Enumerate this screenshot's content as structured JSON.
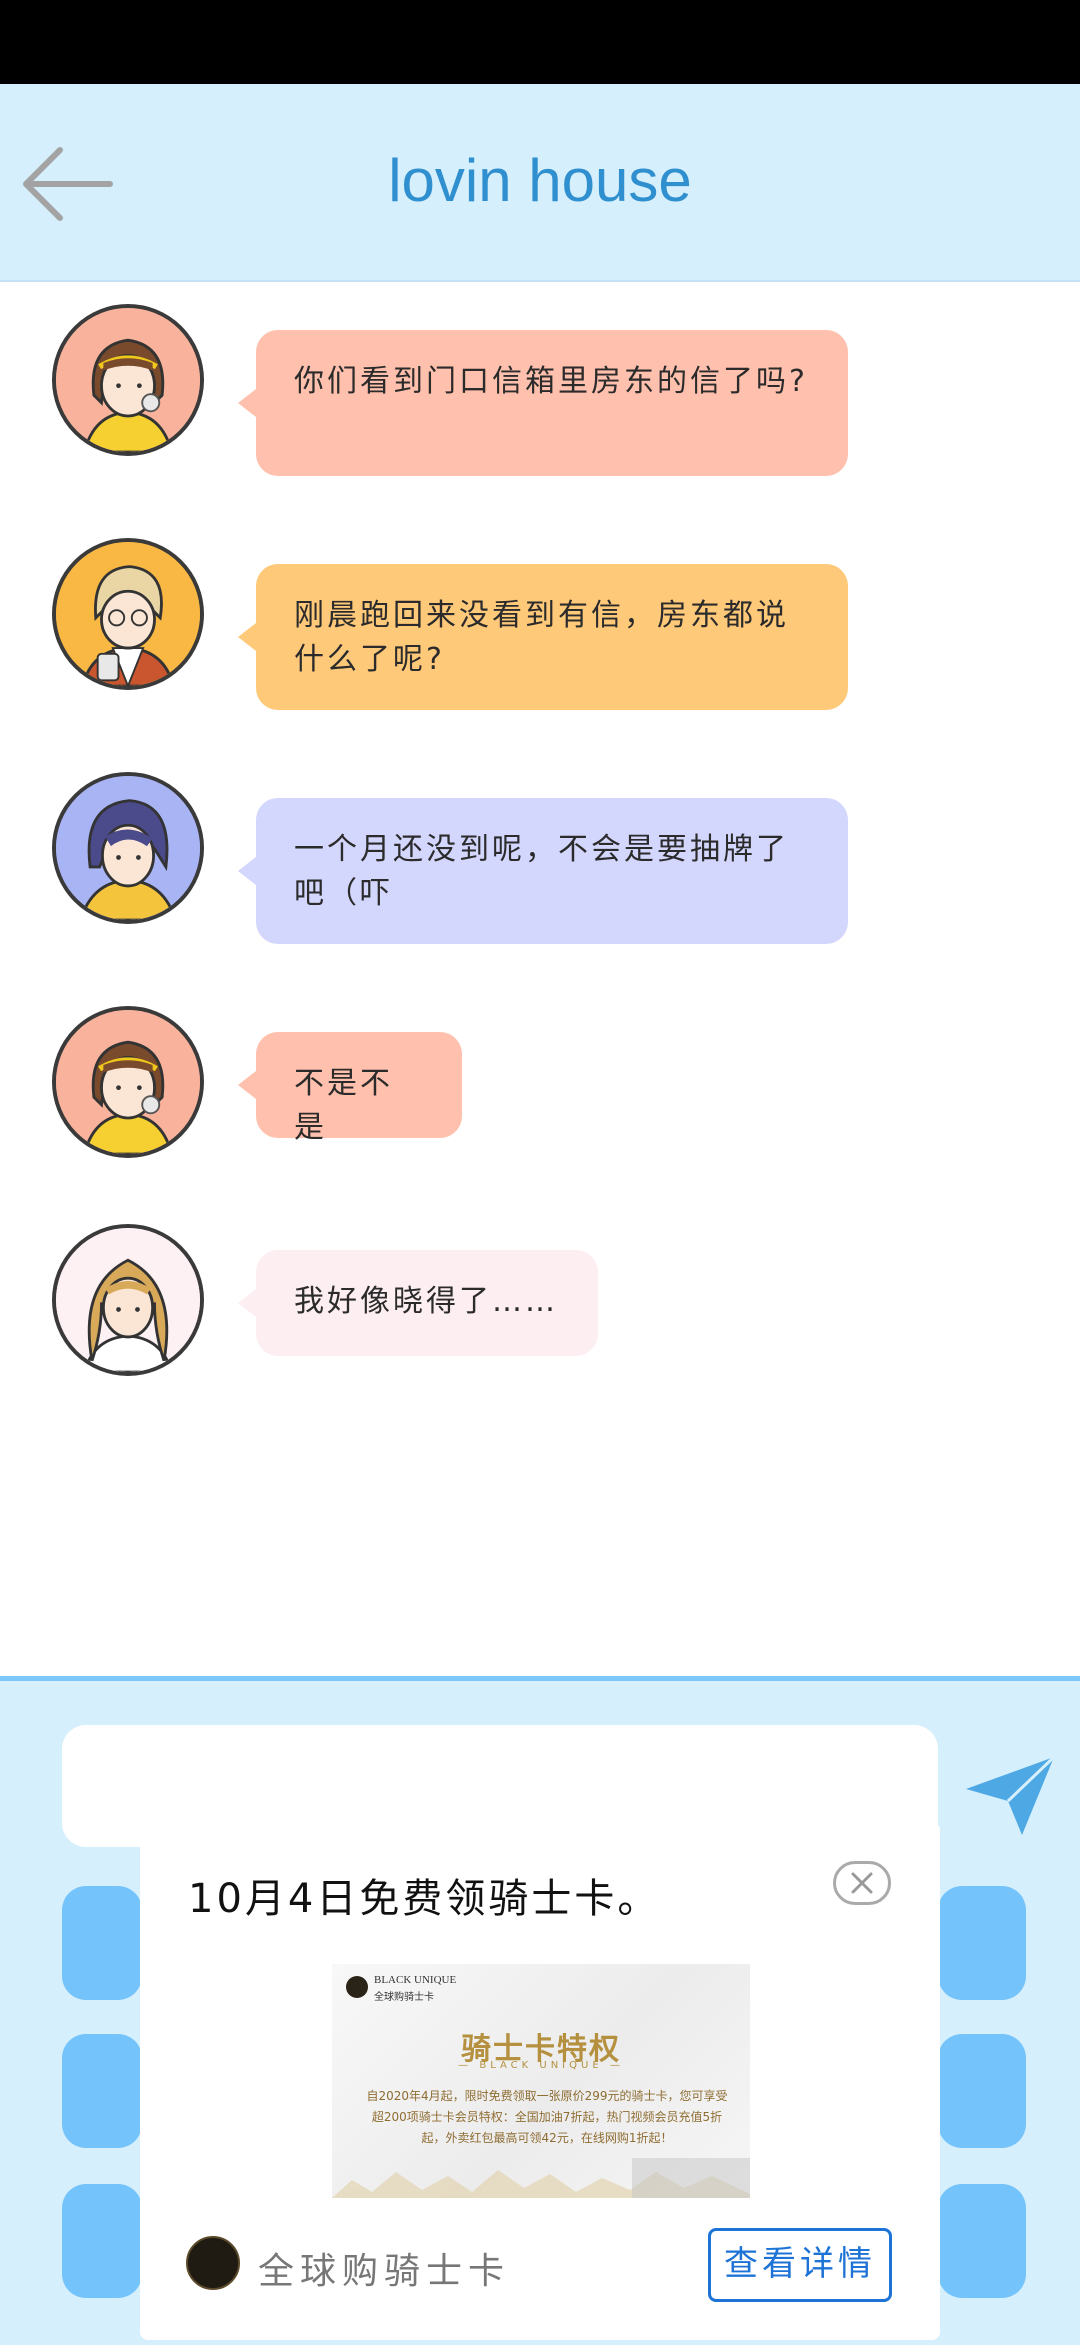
{
  "header": {
    "title": "lovin house"
  },
  "colors": {
    "header_bg": "#d6effc",
    "title": "#2f8fcf",
    "bubble_pink": "#ffc1ad",
    "bubble_orange": "#ffc97a",
    "bubble_lavender": "#d3d6fd",
    "bubble_light": "#fdeef1",
    "quick_button": "#74c3fb",
    "cta": "#1e73d6"
  },
  "messages": [
    {
      "avatar": "girl-headband-avatar",
      "text": "你们看到门口信箱里房东的信了吗?"
    },
    {
      "avatar": "boy-glasses-avatar",
      "text": "刚晨跑回来没看到有信，房东都说什么了呢?"
    },
    {
      "avatar": "boy-dark-hair-avatar",
      "text": "一个月还没到呢，不会是要抽牌了吧（吓"
    },
    {
      "avatar": "girl-headband-avatar",
      "text": "不是不是"
    },
    {
      "avatar": "girl-wavy-hair-avatar",
      "text": "我好像晓得了……"
    }
  ],
  "input": {
    "value": ""
  },
  "ad": {
    "title": "10月4日免费领骑士卡。",
    "image": {
      "brand_en": "BLACK UNIQUE",
      "brand_cn": "全球购骑士卡",
      "headline": "骑士卡特权",
      "subheadline": "— BLACK UNIQUE —",
      "copy": "自2020年4月起，限时免费领取一张原价299元的骑士卡，您可享受超200项骑士卡会员特权：全国加油7折起，热门视频会员充值5折起，外卖红包最高可领42元，在线网购1折起！"
    },
    "footer_label": "全球购骑士卡",
    "cta_label": "查看详情"
  }
}
